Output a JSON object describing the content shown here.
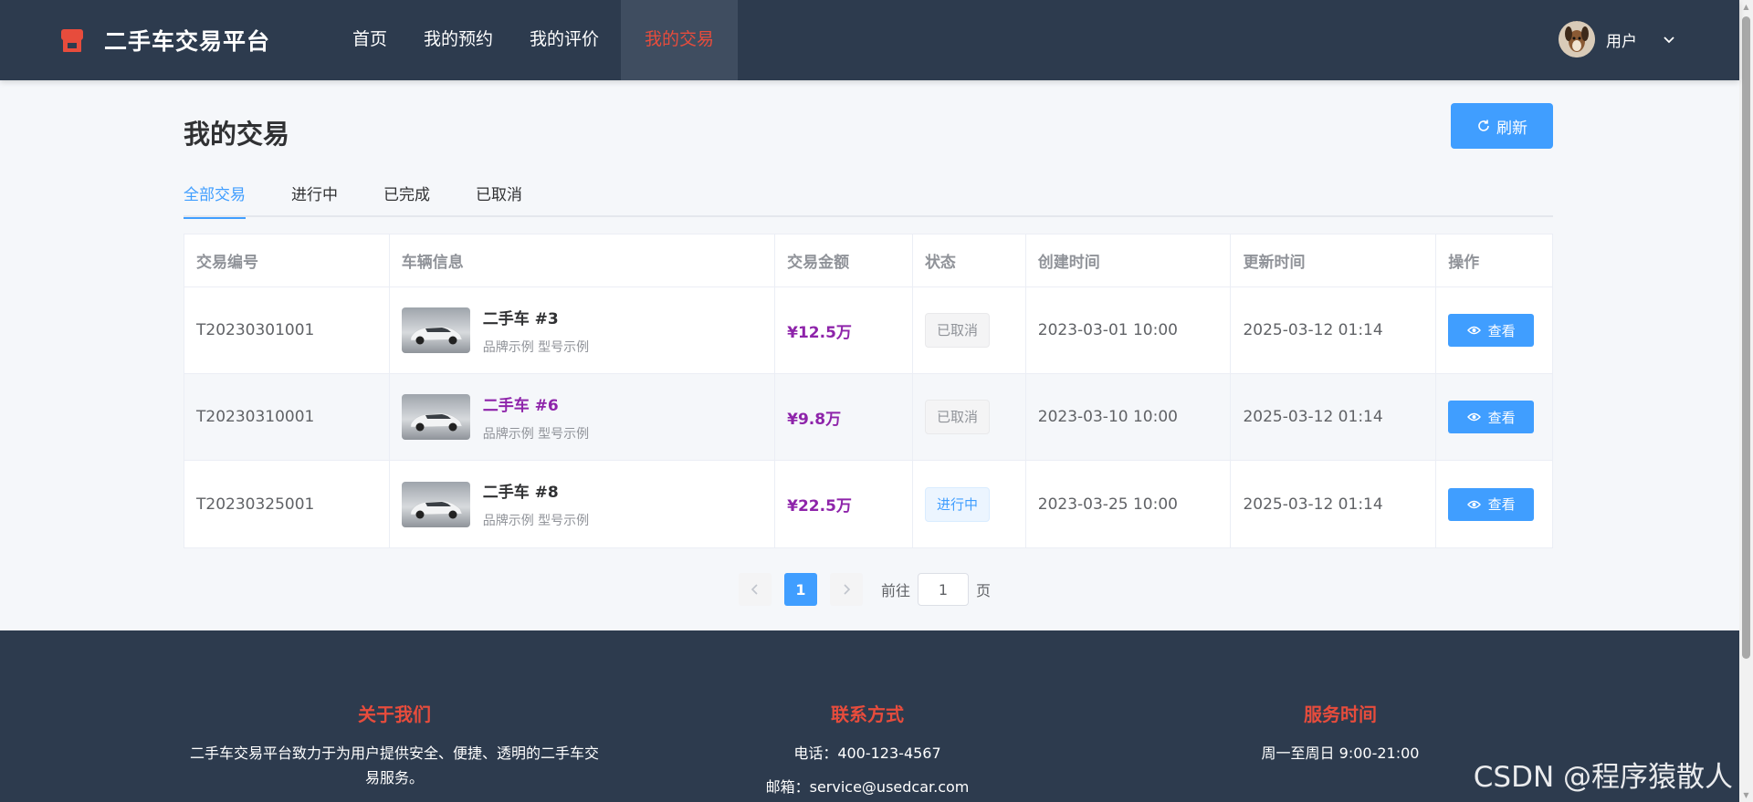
{
  "header": {
    "logo_text": "二手车交易平台",
    "nav": [
      {
        "label": "首页"
      },
      {
        "label": "我的预约"
      },
      {
        "label": "我的评价"
      },
      {
        "label": "我的交易"
      }
    ],
    "active_nav": "我的交易",
    "user_name": "用户",
    "accent_color": "#e74c3c",
    "bg_color": "#2d3b4e"
  },
  "page": {
    "title": "我的交易",
    "refresh_label": "刷新",
    "tabs": [
      "全部交易",
      "进行中",
      "已完成",
      "已取消"
    ],
    "active_tab": "全部交易"
  },
  "table": {
    "columns": [
      "交易编号",
      "车辆信息",
      "交易金额",
      "状态",
      "创建时间",
      "更新时间",
      "操作"
    ],
    "rows": [
      {
        "id": "T20230301001",
        "car_name": "二手车 #3",
        "car_sub": "品牌示例 型号示例",
        "amount": "¥12.5万",
        "status": "已取消",
        "created": "2023-03-01 10:00",
        "updated": "2025-03-12 01:14",
        "action": "查看"
      },
      {
        "id": "T20230310001",
        "car_name": "二手车 #6",
        "car_sub": "品牌示例 型号示例",
        "amount": "¥9.8万",
        "status": "已取消",
        "created": "2023-03-10 10:00",
        "updated": "2025-03-12 01:14",
        "action": "查看"
      },
      {
        "id": "T20230325001",
        "car_name": "二手车 #8",
        "car_sub": "品牌示例 型号示例",
        "amount": "¥22.5万",
        "status": "进行中",
        "created": "2023-03-25 10:00",
        "updated": "2025-03-12 01:14",
        "action": "查看"
      }
    ]
  },
  "pagination": {
    "current": "1",
    "goto_label": "前往",
    "goto_value": "1",
    "page_suffix": "页"
  },
  "footer": {
    "about": {
      "title": "关于我们",
      "text": "二手车交易平台致力于为用户提供安全、便捷、透明的二手车交易服务。"
    },
    "contact": {
      "title": "联系方式",
      "phone": "电话：400-123-4567",
      "email": "邮箱：service@usedcar.com"
    },
    "hours": {
      "title": "服务时间",
      "text": "周一至周日 9:00-21:00"
    }
  },
  "watermark": "CSDN @程序猿散人"
}
